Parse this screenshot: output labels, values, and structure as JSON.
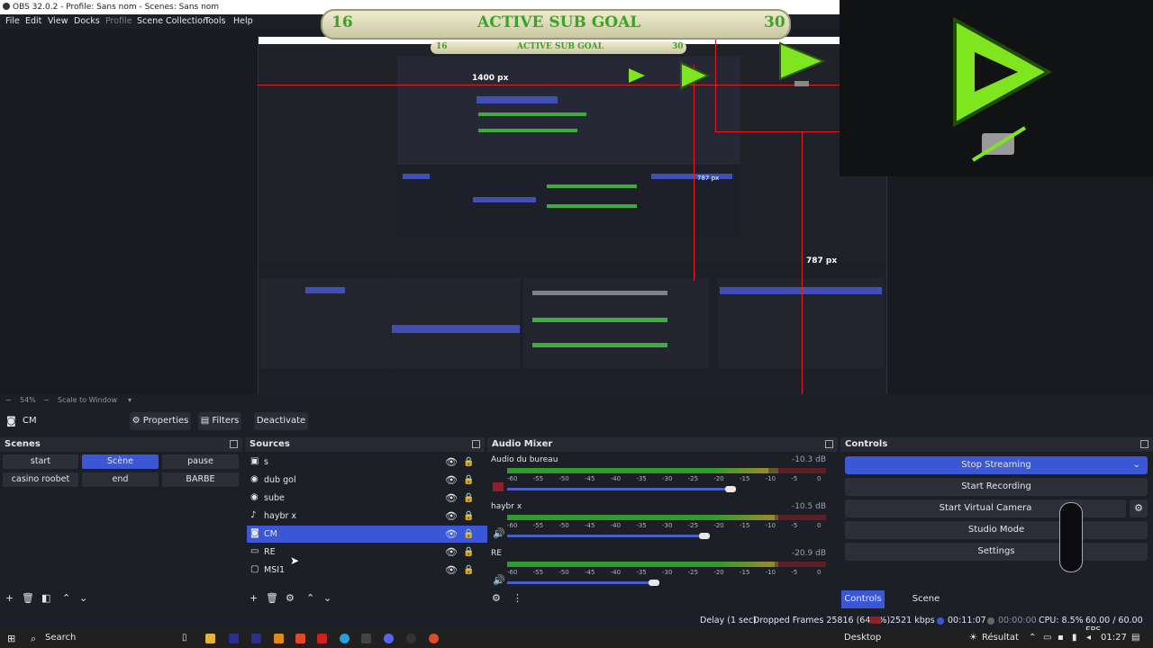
{
  "window": {
    "title": "OBS 32.0.2 - Profile: Sans nom - Scenes: Sans nom"
  },
  "menu": {
    "items": [
      "File",
      "Edit",
      "View",
      "Docks",
      "Profile",
      "Scene Collection",
      "Tools",
      "Help"
    ]
  },
  "overlay": {
    "goal_start": "16",
    "goal_title": "ACTIVE SUB GOAL",
    "goal_end": "30",
    "measure_width": "1400 px",
    "measure_height_a": "787 px",
    "measure_height_b": "787 px"
  },
  "zoom": {
    "value": "54%",
    "mode": "Scale to Window"
  },
  "source_toolbar": {
    "source_name": "CM",
    "properties_label": "Properties",
    "filters_label": "Filters",
    "deactivate_label": "Deactivate"
  },
  "scenes": {
    "title": "Scenes",
    "items": [
      {
        "label": "start"
      },
      {
        "label": "Scène"
      },
      {
        "label": "pause"
      },
      {
        "label": "casino roobet"
      },
      {
        "label": "end"
      },
      {
        "label": "BARBE"
      }
    ]
  },
  "sources": {
    "title": "Sources",
    "items": [
      {
        "label": "s",
        "icon": "text-icon"
      },
      {
        "label": "dub gol",
        "icon": "browser-icon"
      },
      {
        "label": "sube",
        "icon": "browser-icon"
      },
      {
        "label": "haybr x",
        "icon": "mic-icon"
      },
      {
        "label": "CM",
        "icon": "camera-icon"
      },
      {
        "label": "RE",
        "icon": "gamepad-icon"
      },
      {
        "label": "MSI1",
        "icon": "monitor-icon"
      }
    ]
  },
  "mixer": {
    "title": "Audio Mixer",
    "channels": [
      {
        "name": "Audio du bureau",
        "db": "-10.3 dB",
        "level": 0.82,
        "volume": 0.7
      },
      {
        "name": "haybr x",
        "db": "-10.5 dB",
        "level": 0.84,
        "volume": 0.62
      },
      {
        "name": "RE",
        "db": "-20.9 dB",
        "level": 0.84,
        "volume": 0.46
      }
    ],
    "scale": [
      "-60",
      "-55",
      "-50",
      "-45",
      "-40",
      "-35",
      "-30",
      "-25",
      "-20",
      "-15",
      "-10",
      "-5",
      "0"
    ]
  },
  "controls": {
    "title": "Controls",
    "stop_streaming": "Stop Streaming",
    "start_recording": "Start Recording",
    "start_virtual_camera": "Start Virtual Camera",
    "studio_mode": "Studio Mode",
    "settings": "Settings",
    "tabs": [
      "Controls",
      "Scene Transitions"
    ]
  },
  "status": {
    "delay": "Delay (1 sec)",
    "dropped": "Dropped Frames 25816 (64.8%)",
    "bitrate": "2521 kbps",
    "stream_time": "00:11:07",
    "rec_time": "00:00:00",
    "cpu": "CPU: 8.5%",
    "fps": "60.00 / 60.00 FPS"
  },
  "taskbar": {
    "search": "Search",
    "desktop": "Desktop",
    "weather": "Résultat",
    "time": "01:27"
  },
  "colors": {
    "accent": "#3b57d6",
    "meter_green": "#2f9b2f",
    "meter_yellow": "#9b8a2a",
    "meter_red": "#8f1f2a",
    "goal_green": "#3ea226",
    "logo_green": "#7ee51e"
  }
}
